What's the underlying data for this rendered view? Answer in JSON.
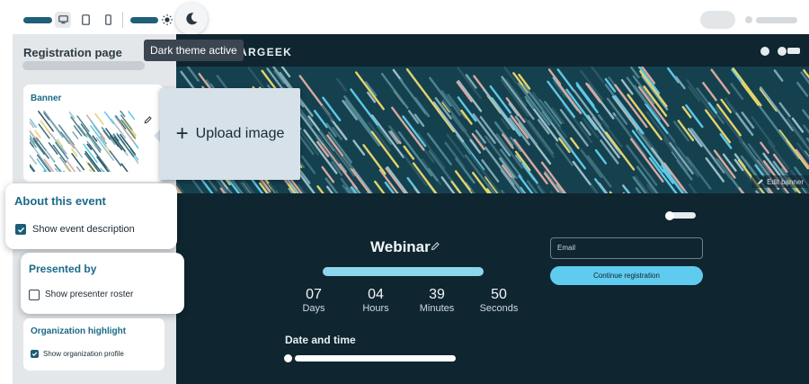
{
  "tooltip": {
    "text": "Dark theme active"
  },
  "sidebar": {
    "title": "Registration page",
    "banner": {
      "title": "Banner"
    },
    "upload": {
      "label": "Upload image"
    },
    "about": {
      "title": "About this event",
      "option": "Show event description",
      "checked": true
    },
    "presented": {
      "title": "Presented by",
      "option": "Show presenter roster",
      "checked": false
    },
    "org": {
      "title": "Organization highlight",
      "option": "Show organization profile",
      "checked": true
    }
  },
  "preview": {
    "brand": "ARGEEK",
    "edit_banner": "Edit banner",
    "event_title": "Webinar",
    "countdown": [
      {
        "value": "07",
        "unit": "Days"
      },
      {
        "value": "04",
        "unit": "Hours"
      },
      {
        "value": "39",
        "unit": "Minutes"
      },
      {
        "value": "50",
        "unit": "Seconds"
      }
    ],
    "email_placeholder": "Email",
    "continue_label": "Continue registration",
    "date_time_title": "Date and time"
  },
  "colors": {
    "accent": "#5fcbef",
    "brand_dark": "#1b5e78",
    "preview_bg": "#0f2530"
  }
}
